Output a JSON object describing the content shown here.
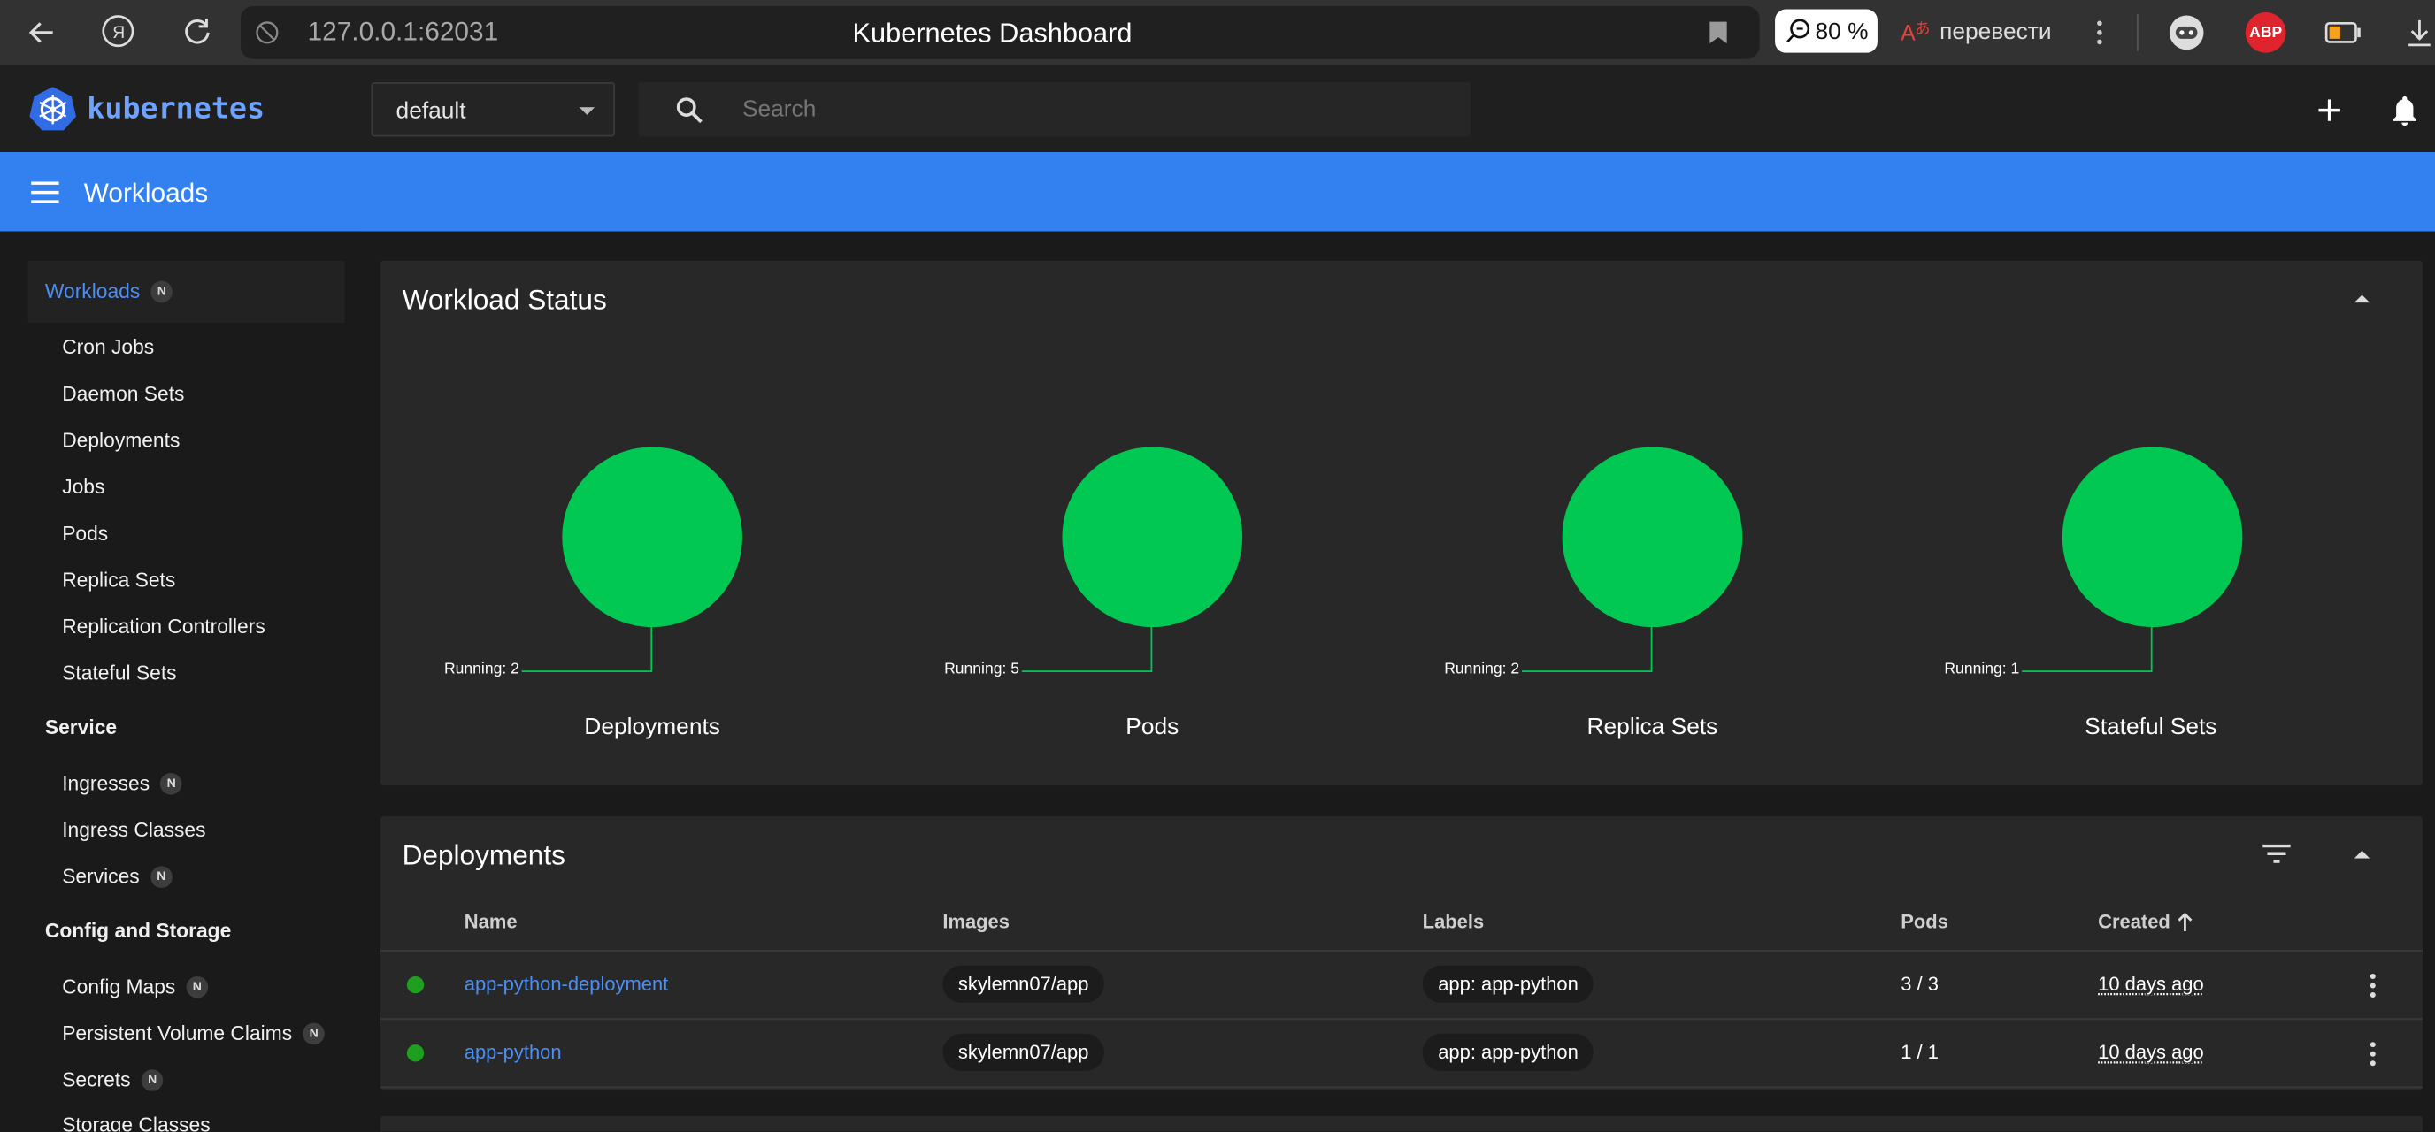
{
  "browser": {
    "url": "127.0.0.1:62031",
    "page_title": "Kubernetes Dashboard",
    "zoom": "80 %",
    "translate_label": "перевести",
    "adblock_label": "ABP"
  },
  "app": {
    "logo_text": "kubernetes",
    "namespace": "default",
    "search_placeholder": "Search",
    "section_title": "Workloads"
  },
  "sidebar": {
    "workloads": {
      "label": "Workloads",
      "badge": "N"
    },
    "workload_items": [
      "Cron Jobs",
      "Daemon Sets",
      "Deployments",
      "Jobs",
      "Pods",
      "Replica Sets",
      "Replication Controllers",
      "Stateful Sets"
    ],
    "service": {
      "label": "Service"
    },
    "service_items": [
      {
        "label": "Ingresses",
        "badge": "N"
      },
      {
        "label": "Ingress Classes",
        "badge": ""
      },
      {
        "label": "Services",
        "badge": "N"
      }
    ],
    "config": {
      "label": "Config and Storage"
    },
    "config_items": [
      {
        "label": "Config Maps",
        "badge": "N"
      },
      {
        "label": "Persistent Volume Claims",
        "badge": "N"
      },
      {
        "label": "Secrets",
        "badge": "N"
      },
      {
        "label": "Storage Classes",
        "badge": ""
      }
    ]
  },
  "workload_status": {
    "title": "Workload Status",
    "charts": [
      {
        "name": "Deployments",
        "running_label": "Running: 2",
        "running": 2
      },
      {
        "name": "Pods",
        "running_label": "Running: 5",
        "running": 5
      },
      {
        "name": "Replica Sets",
        "running_label": "Running: 2",
        "running": 2
      },
      {
        "name": "Stateful Sets",
        "running_label": "Running: 1",
        "running": 1
      }
    ]
  },
  "deployments": {
    "title": "Deployments",
    "columns": [
      "Name",
      "Images",
      "Labels",
      "Pods",
      "Created"
    ],
    "rows": [
      {
        "name": "app-python-deployment",
        "image": "skylemn07/app",
        "label": "app: app-python",
        "pods": "3 / 3",
        "created": "10 days ago"
      },
      {
        "name": "app-python",
        "image": "skylemn07/app",
        "label": "app: app-python",
        "pods": "1 / 1",
        "created": "10 days ago"
      }
    ]
  },
  "colors": {
    "accent": "#3381f0",
    "running": "#00c853",
    "status_ok": "#1ea01e"
  }
}
